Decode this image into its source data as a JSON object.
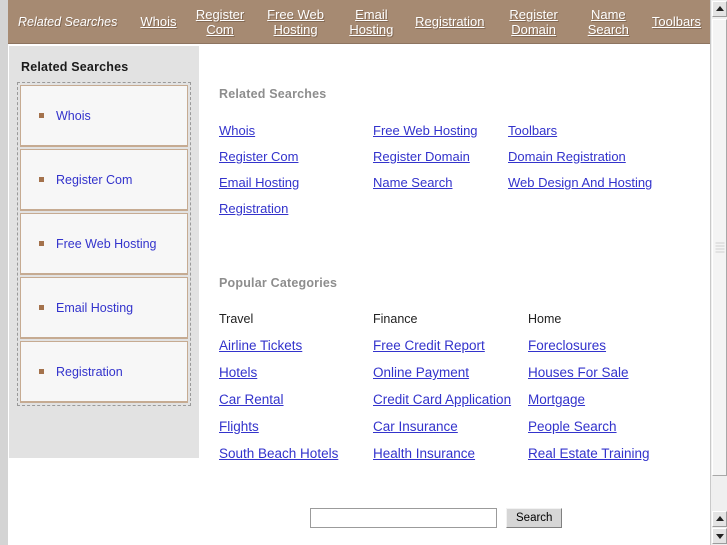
{
  "topnav": {
    "brand": "Related Searches",
    "links": [
      {
        "label": "Whois"
      },
      {
        "label": "Register Com"
      },
      {
        "label": "Free Web Hosting"
      },
      {
        "label": "Email Hosting"
      },
      {
        "label": "Registration"
      },
      {
        "label": "Register Domain"
      },
      {
        "label": "Name Search"
      },
      {
        "label": "Toolbars"
      }
    ],
    "bg_color": "#a68a72",
    "text_color": "#ffffff"
  },
  "sidebar": {
    "title": "Related Searches",
    "items": [
      {
        "label": "Whois"
      },
      {
        "label": "Register Com"
      },
      {
        "label": "Free Web Hosting"
      },
      {
        "label": "Email Hosting"
      },
      {
        "label": "Registration"
      }
    ],
    "bg_color": "#e2e2e2",
    "bullet_color": "#a4724c",
    "link_color": "#3333cc"
  },
  "main": {
    "related": {
      "title": "Related Searches",
      "links": [
        "Whois",
        "Free Web Hosting",
        "Toolbars",
        "Register Com",
        "Register Domain",
        "Domain Registration",
        "Email Hosting",
        "Name Search",
        "Web Design And Hosting",
        "Registration",
        "",
        ""
      ]
    },
    "popular": {
      "title": "Popular Categories",
      "cells": [
        "Travel",
        "Finance",
        "Home",
        "Airline Tickets",
        "Free Credit Report",
        "Foreclosures",
        "Hotels",
        "Online Payment",
        "Houses For Sale",
        "Car Rental",
        "Credit Card Application",
        "Mortgage",
        "Flights",
        "Car Insurance",
        "People Search",
        "South Beach Hotels",
        "Health Insurance",
        "Real Estate Training"
      ]
    }
  },
  "search": {
    "value": "",
    "placeholder": "",
    "button_label": "Search"
  },
  "scrollbar": {
    "up_icon": "triangle-up",
    "down_icon": "triangle-down"
  }
}
